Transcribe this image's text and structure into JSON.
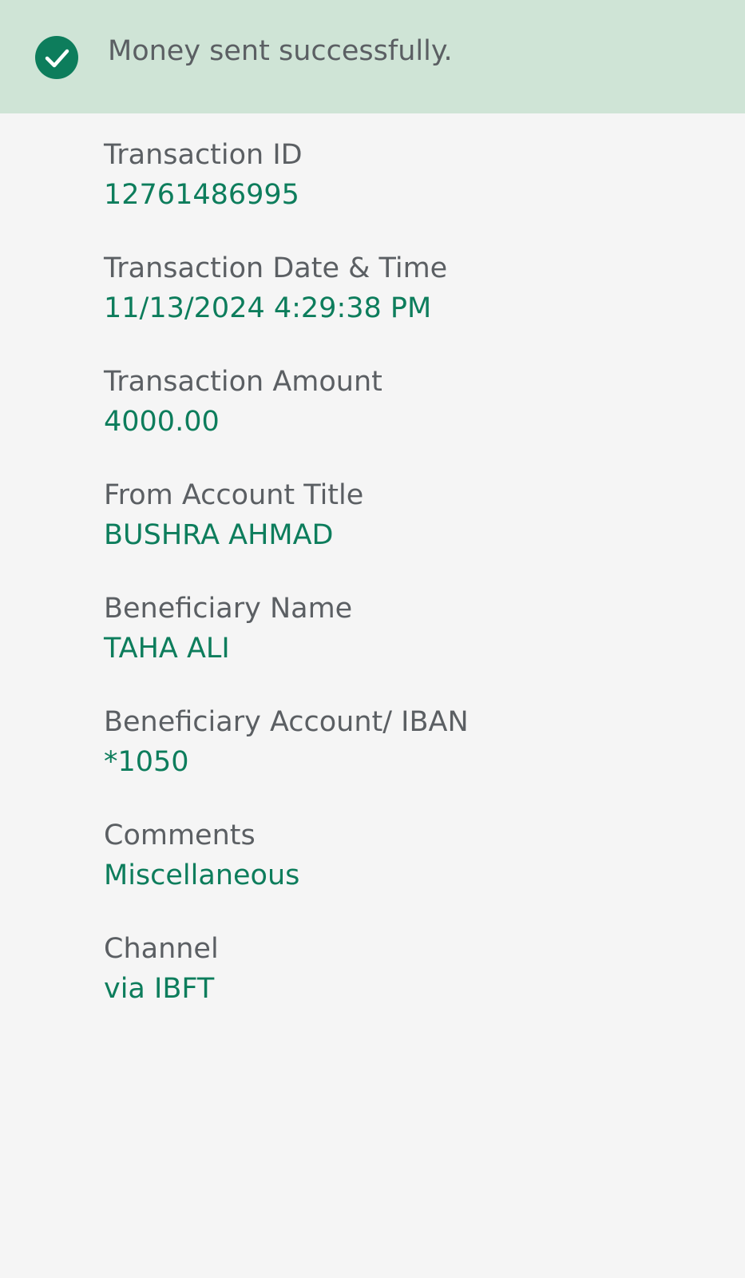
{
  "banner": {
    "message": "Money sent successfully.",
    "icon": "check-circle-icon",
    "background_color": "#cfe4d6",
    "icon_color": "#0d7d5c"
  },
  "details": [
    {
      "label": "Transaction ID",
      "value": "12761486995"
    },
    {
      "label": "Transaction Date & Time",
      "value": "11/13/2024 4:29:38 PM"
    },
    {
      "label": "Transaction Amount",
      "value": "4000.00"
    },
    {
      "label": "From Account Title",
      "value": "BUSHRA AHMAD"
    },
    {
      "label": "Beneficiary Name",
      "value": "TAHA ALI"
    },
    {
      "label": "Beneficiary Account/ IBAN",
      "value": "*1050"
    },
    {
      "label": "Comments",
      "value": "Miscellaneous"
    },
    {
      "label": "Channel",
      "value": "via IBFT"
    }
  ],
  "colors": {
    "label": "#5b5f63",
    "value": "#0d7d5c",
    "page_background": "#f5f5f5"
  }
}
